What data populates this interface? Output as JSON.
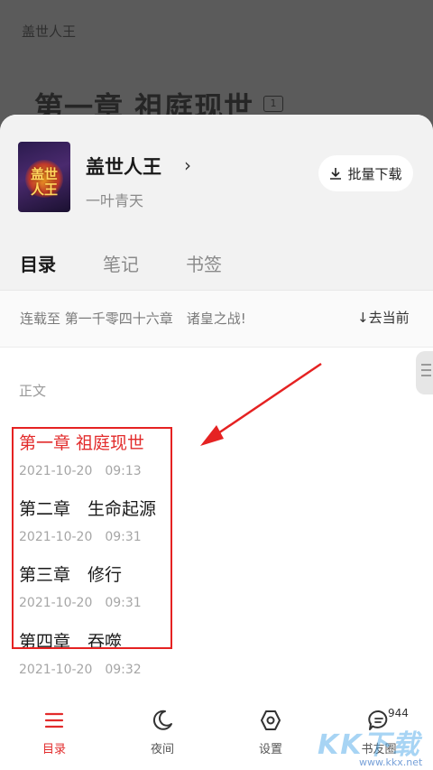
{
  "reader": {
    "book_title": "盖世人王",
    "chapter_title": "第一章 祖庭现世",
    "comment_count": "1"
  },
  "book": {
    "title": "盖世人王",
    "author": "一叶青天",
    "cover_text": "盖世人王",
    "batch_download_label": "批量下载"
  },
  "tabs": [
    {
      "label": "目录",
      "active": true
    },
    {
      "label": "笔记",
      "active": false
    },
    {
      "label": "书签",
      "active": false
    }
  ],
  "serial": {
    "text": "连载至 第一千零四十六章　诸皇之战!",
    "goto_current_label": "去当前"
  },
  "section_label": "正文",
  "chapters": [
    {
      "title": "第一章 祖庭现世",
      "time": "2021-10-20　09:13",
      "current": true
    },
    {
      "title": "第二章　生命起源",
      "time": "2021-10-20　09:31",
      "current": false
    },
    {
      "title": "第三章　修行",
      "time": "2021-10-20　09:31",
      "current": false
    },
    {
      "title": "第四章　吞噬",
      "time": "2021-10-20　09:32",
      "current": false
    }
  ],
  "bottom_nav": [
    {
      "label": "目录",
      "icon": "list-icon",
      "active": true
    },
    {
      "label": "夜间",
      "icon": "moon-icon",
      "active": false
    },
    {
      "label": "设置",
      "icon": "settings-icon",
      "active": false
    },
    {
      "label": "书友圈",
      "icon": "chat-icon",
      "active": false
    }
  ],
  "book_circle_badge": "944",
  "watermark": {
    "text": "KK下载",
    "url": "www.kkx.net"
  },
  "colors": {
    "accent": "#e22b2b",
    "overlay": "#5b5b5b",
    "header_bg": "#f2f2f2"
  }
}
